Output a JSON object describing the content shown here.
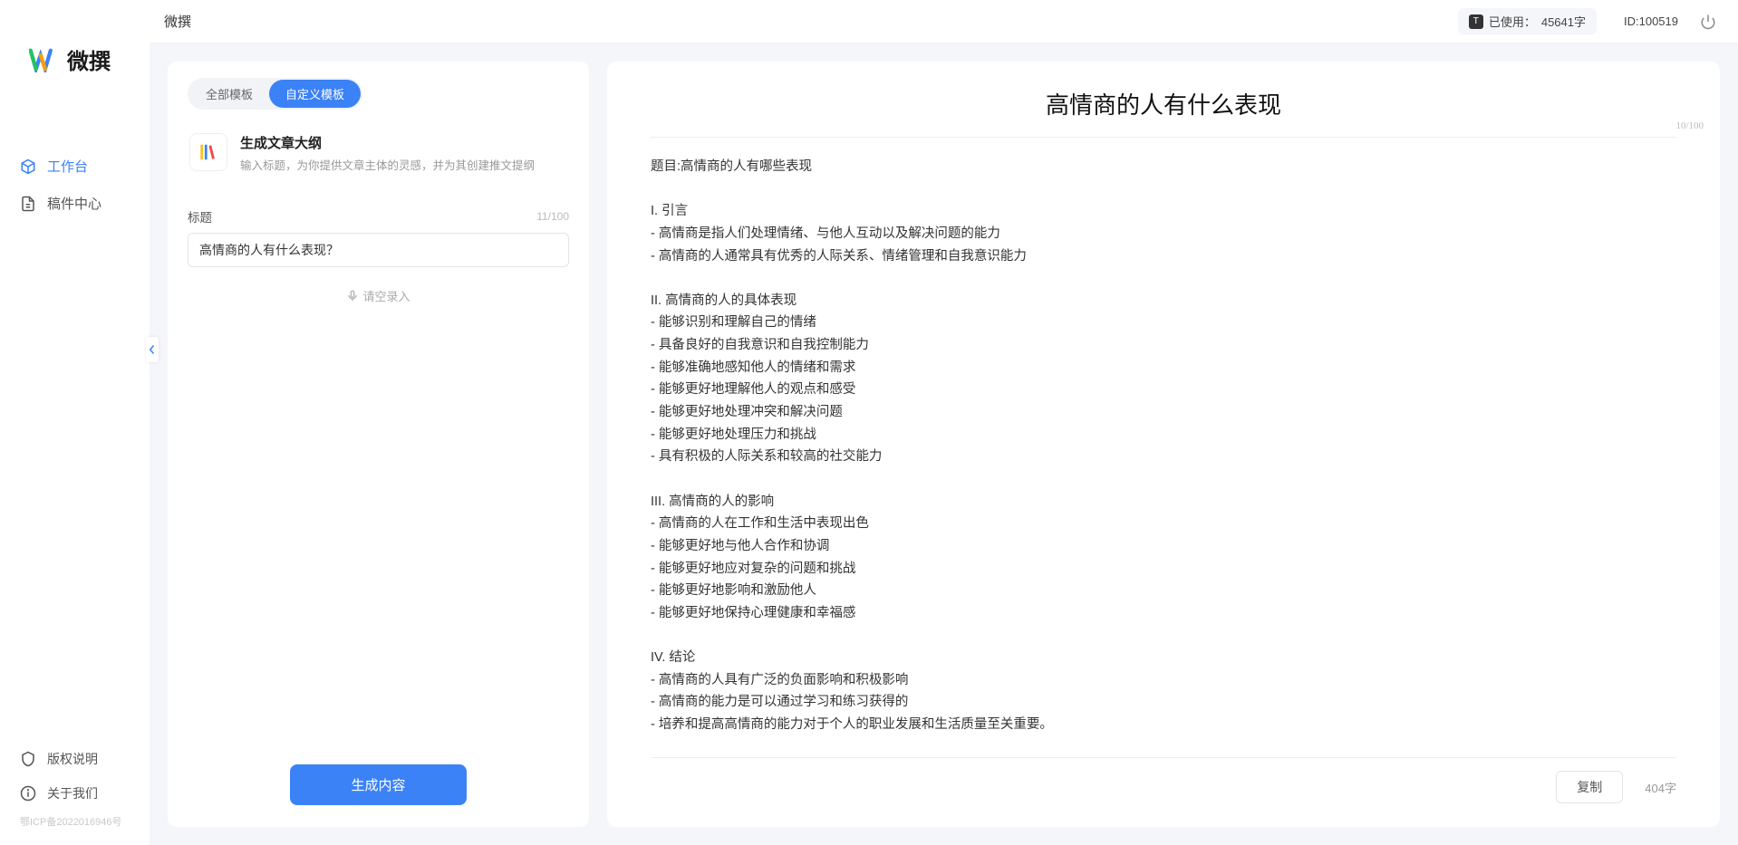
{
  "brand": {
    "name": "微撰"
  },
  "sidebar": {
    "items": [
      {
        "label": "工作台"
      },
      {
        "label": "稿件中心"
      }
    ],
    "bottom": [
      {
        "label": "版权说明"
      },
      {
        "label": "关于我们"
      }
    ],
    "icp": "鄂ICP备2022016946号"
  },
  "topbar": {
    "title": "微撰",
    "usage_label": "已使用：",
    "usage_value": "45641字",
    "user_id": "ID:100519"
  },
  "left": {
    "tabs": [
      {
        "label": "全部模板"
      },
      {
        "label": "自定义模板"
      }
    ],
    "template": {
      "title": "生成文章大纲",
      "desc": "输入标题，为你提供文章主体的灵感，并为其创建推文提纲"
    },
    "field_label": "标题",
    "field_counter": "11/100",
    "input_value": "高情商的人有什么表现？",
    "voice_label": "请空录入",
    "generate_label": "生成内容"
  },
  "right": {
    "title": "高情商的人有什么表现",
    "title_counter": "10/100",
    "body": "题目:高情商的人有哪些表现\n\nI. 引言\n- 高情商是指人们处理情绪、与他人互动以及解决问题的能力\n- 高情商的人通常具有优秀的人际关系、情绪管理和自我意识能力\n\nII. 高情商的人的具体表现\n- 能够识别和理解自己的情绪\n- 具备良好的自我意识和自我控制能力\n- 能够准确地感知他人的情绪和需求\n- 能够更好地理解他人的观点和感受\n- 能够更好地处理冲突和解决问题\n- 能够更好地处理压力和挑战\n- 具有积极的人际关系和较高的社交能力\n\nIII. 高情商的人的影响\n- 高情商的人在工作和生活中表现出色\n- 能够更好地与他人合作和协调\n- 能够更好地应对复杂的问题和挑战\n- 能够更好地影响和激励他人\n- 能够更好地保持心理健康和幸福感\n\nIV. 结论\n- 高情商的人具有广泛的负面影响和积极影响\n- 高情商的能力是可以通过学习和练习获得的\n- 培养和提高高情商的能力对于个人的职业发展和生活质量至关重要。",
    "copy_label": "复制",
    "word_count": "404字"
  }
}
